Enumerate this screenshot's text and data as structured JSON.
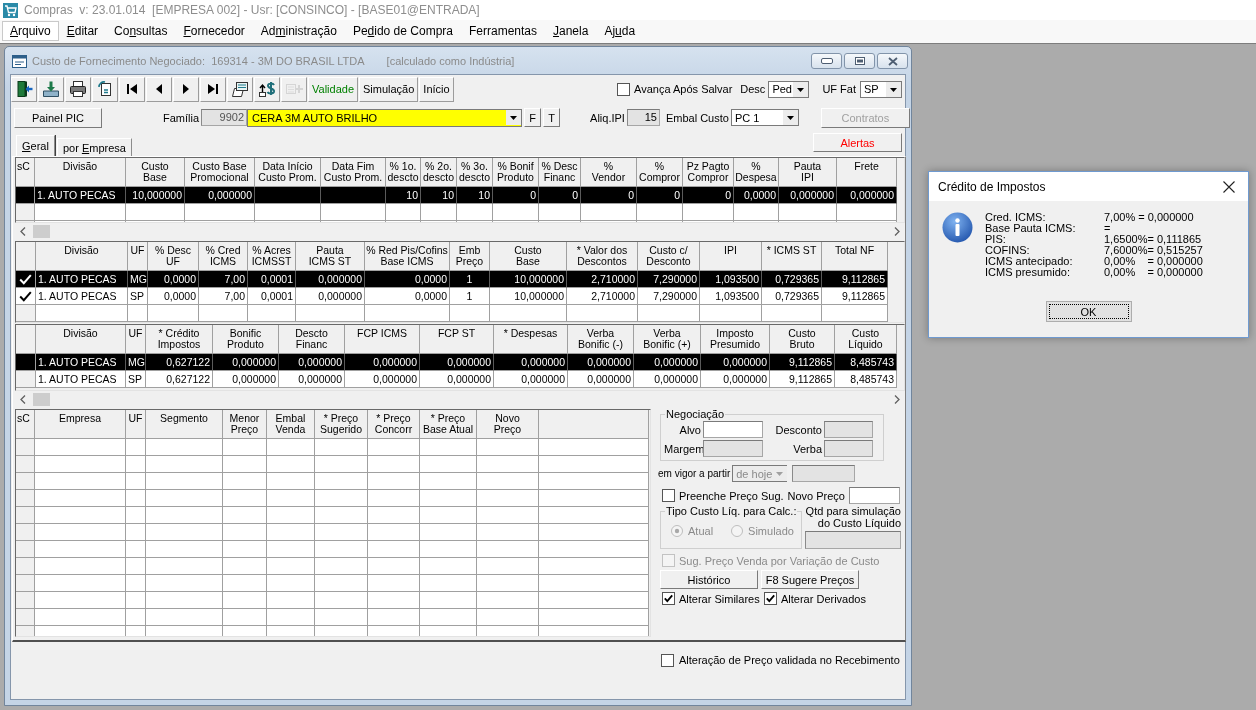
{
  "app_window": {
    "title": "Compras  v: 23.01.014  [EMPRESA 002] - Usr: [CONSINCO] - [BASE01@ENTRADA]"
  },
  "menu": [
    {
      "key": "A",
      "post": "rquivo",
      "selected": true
    },
    {
      "key": "E",
      "post": "ditar",
      "selected": false
    },
    {
      "pre": "Co",
      "key": "n",
      "post": "sultas",
      "selected": false
    },
    {
      "key": "F",
      "post": "ornecedor",
      "selected": false
    },
    {
      "pre": "Ad",
      "key": "m",
      "post": "inistração",
      "selected": false
    },
    {
      "pre": "Pe",
      "key": "d",
      "post": "ido de Compra",
      "selected": false
    },
    {
      "pre": "Ferramentas",
      "selected": false
    },
    {
      "key": "J",
      "post": "anela",
      "selected": false
    },
    {
      "pre": "Aj",
      "key": "u",
      "post": "da",
      "selected": false
    }
  ],
  "form_window": {
    "title": "Custo de Fornecimento Negociado:  169314 - 3M DO BRASIL LTDA",
    "note": "[calculado como Indústria]",
    "toolbar": {
      "icon_buttons": [
        {
          "disabled": false
        },
        {
          "disabled": false
        },
        {
          "disabled": false
        },
        {
          "disabled": false
        },
        {
          "disabled": false
        },
        {
          "disabled": false
        },
        {
          "disabled": false
        },
        {
          "disabled": false
        },
        {
          "disabled": false
        },
        {
          "disabled": false
        },
        {
          "disabled": true
        }
      ],
      "text_buttons": [
        {
          "label": "Validade",
          "color": "#008000"
        },
        {
          "label": "Simulação"
        },
        {
          "label": "Início"
        }
      ],
      "advance_after_save": {
        "label": "Avança Após Salvar",
        "checked": false
      },
      "desc": {
        "label": "Desc",
        "value": "Ped"
      },
      "uf_fat": {
        "label": "UF Fat",
        "value": "SP"
      }
    },
    "painel_pic": "Painel PIC",
    "familia": {
      "label": "Família",
      "code": "9902",
      "value": "CERA 3M AUTO BRILHO"
    },
    "family_buttons": [
      "F",
      "T"
    ],
    "aliq_ipi": {
      "label": "Aliq.IPI",
      "value": "15"
    },
    "embal_custo": {
      "label": "Embal Custo",
      "value": "PC 1"
    },
    "side_buttons": [
      {
        "label": "Contratos",
        "disabled": true
      },
      {
        "label": "Alertas",
        "disabled": false,
        "color": "#ff0000"
      }
    ],
    "tabs": [
      {
        "key": "G",
        "post": "eral",
        "selected": true
      },
      {
        "pre": "por ",
        "key": "E",
        "post": "mpresa",
        "selected": false
      }
    ],
    "cost_table": {
      "marker_header": "sC",
      "columns": [
        "Divisão",
        "Custo\nBase",
        "Custo Base\nPromocional",
        "Data Início\nCusto Prom.",
        "Data Fim\nCusto Prom.",
        "% 1o.\ndescto",
        "% 2o.\ndescto",
        "% 3o.\ndescto",
        "% Bonif\nProduto",
        "% Desc\nFinanc",
        "%\nVendor",
        "%\nCompror",
        "Pz Pagto\nCompror",
        "%\nDespesa",
        "Pauta\nIPI",
        "Frete"
      ],
      "rows": [
        {
          "selected": true,
          "cells": [
            "1. AUTO PECAS",
            "10,000000",
            "0,000000",
            null,
            null,
            "10",
            "10",
            "10",
            "0",
            "0",
            "0",
            "0",
            "0",
            "0,0000",
            "0,000000",
            "0,000000"
          ]
        }
      ]
    },
    "division_table": {
      "columns": [
        "Divisão",
        "UF",
        "% Desc\nUF",
        "% Cred\nICMS",
        "% Acres\nICMSST",
        "Pauta\nICMS ST",
        "% Red Pis/Cofins\nBase ICMS",
        "Emb\nPreço",
        "Custo\nBase",
        "* Valor dos\nDescontos",
        "Custo c/\nDesconto",
        "IPI",
        "* ICMS ST",
        "Total NF"
      ],
      "rows": [
        {
          "selected": true,
          "checked": true,
          "cells": [
            "1. AUTO PECAS",
            "MG",
            "0,0000",
            "7,00",
            "0,0001",
            "0,000000",
            "0,0000",
            "1",
            "10,000000",
            "2,710000",
            "7,290000",
            "1,093500",
            "0,729365",
            "9,112865"
          ]
        },
        {
          "selected": false,
          "checked": true,
          "cells": [
            "1. AUTO PECAS",
            "SP",
            "0,0000",
            "7,00",
            "0,0001",
            "0,000000",
            "0,0000",
            "1",
            "10,000000",
            "2,710000",
            "7,290000",
            "1,093500",
            "0,729365",
            "9,112865"
          ]
        }
      ]
    },
    "taxes_table": {
      "columns": [
        "Divisão",
        "UF",
        "* Crédito\nImpostos",
        "Bonific\nProduto",
        "Descto\nFinanc",
        "FCP ICMS",
        "FCP ST",
        "* Despesas",
        "Verba\nBonific (-)",
        "Verba\nBonific (+)",
        "Imposto\nPresumido",
        "Custo\nBruto",
        "Custo\nLíquido"
      ],
      "rows": [
        {
          "selected": true,
          "cells": [
            "1. AUTO PECAS",
            "MG",
            "0,627122",
            "0,000000",
            "0,000000",
            "0,000000",
            "0,000000",
            "0,000000",
            "0,000000",
            "0,000000",
            "0,000000",
            "9,112865",
            "8,485743"
          ]
        },
        {
          "selected": false,
          "cells": [
            "1. AUTO PECAS",
            "SP",
            "0,627122",
            "0,000000",
            "0,000000",
            "0,000000",
            "0,000000",
            "0,000000",
            "0,000000",
            "0,000000",
            "0,000000",
            "9,112865",
            "8,485743"
          ]
        }
      ]
    },
    "price_table": {
      "marker_header": "sC",
      "columns": [
        "Empresa",
        "UF",
        "Segmento",
        "Menor\nPreço",
        "Embal\nVenda",
        "* Preço\nSugerido",
        "* Preço\nConcorr",
        "* Preço\nBase Atual",
        "Novo\nPreço"
      ]
    },
    "negotiation": {
      "title": "Negociação",
      "fields": [
        {
          "label": "Alvo",
          "disabled": false
        },
        {
          "label": "Desconto",
          "disabled": true
        },
        {
          "label": "Margem",
          "disabled": true
        },
        {
          "label": "Verba",
          "disabled": true
        }
      ]
    },
    "start_date": {
      "label": "em vigor a partir",
      "value": "de hoje",
      "disabled": true
    },
    "prefill": {
      "label": "Preenche Preço Sug.",
      "checked": false
    },
    "new_price": {
      "label": "Novo Preço",
      "disabled": false
    },
    "cost_type": {
      "title": "Tipo Custo Líq. para Calc.:",
      "disabled": true,
      "options": [
        {
          "label": "Atual",
          "selected": true
        },
        {
          "label": "Simulado",
          "selected": false
        }
      ]
    },
    "simulation_qty": {
      "label": "Qtd para simulação\ndo Custo Líquido",
      "disabled": true
    },
    "suggest_by_variation": {
      "label": "Sug. Preço Venda por Variação de Custo",
      "checked": false,
      "disabled": true
    },
    "panel_buttons": [
      "Histórico",
      "F8 Sugere Preços"
    ],
    "alter_options": [
      {
        "label": "Alterar Similares",
        "checked": true
      },
      {
        "label": "Alterar Derivados",
        "checked": true
      }
    ],
    "receipt_validation": {
      "label": "Alteração de Preço validada no Recebimento",
      "checked": false
    }
  },
  "dialog": {
    "title": "Crédito de Impostos",
    "lines": [
      {
        "label": "Cred. ICMS:",
        "value": "7,00% = 0,000000"
      },
      {
        "label": "Base Pauta ICMS:",
        "value": "="
      },
      {
        "label": "PIS:",
        "value": "1,6500%= 0,111865"
      },
      {
        "label": "COFINS:",
        "value": "7,6000%= 0,515257"
      },
      {
        "label": "ICMS antecipado:",
        "value": "0,00%    = 0,000000"
      },
      {
        "label": "ICMS presumido:",
        "value": "0,00%    = 0,000000"
      }
    ],
    "button": "OK"
  }
}
